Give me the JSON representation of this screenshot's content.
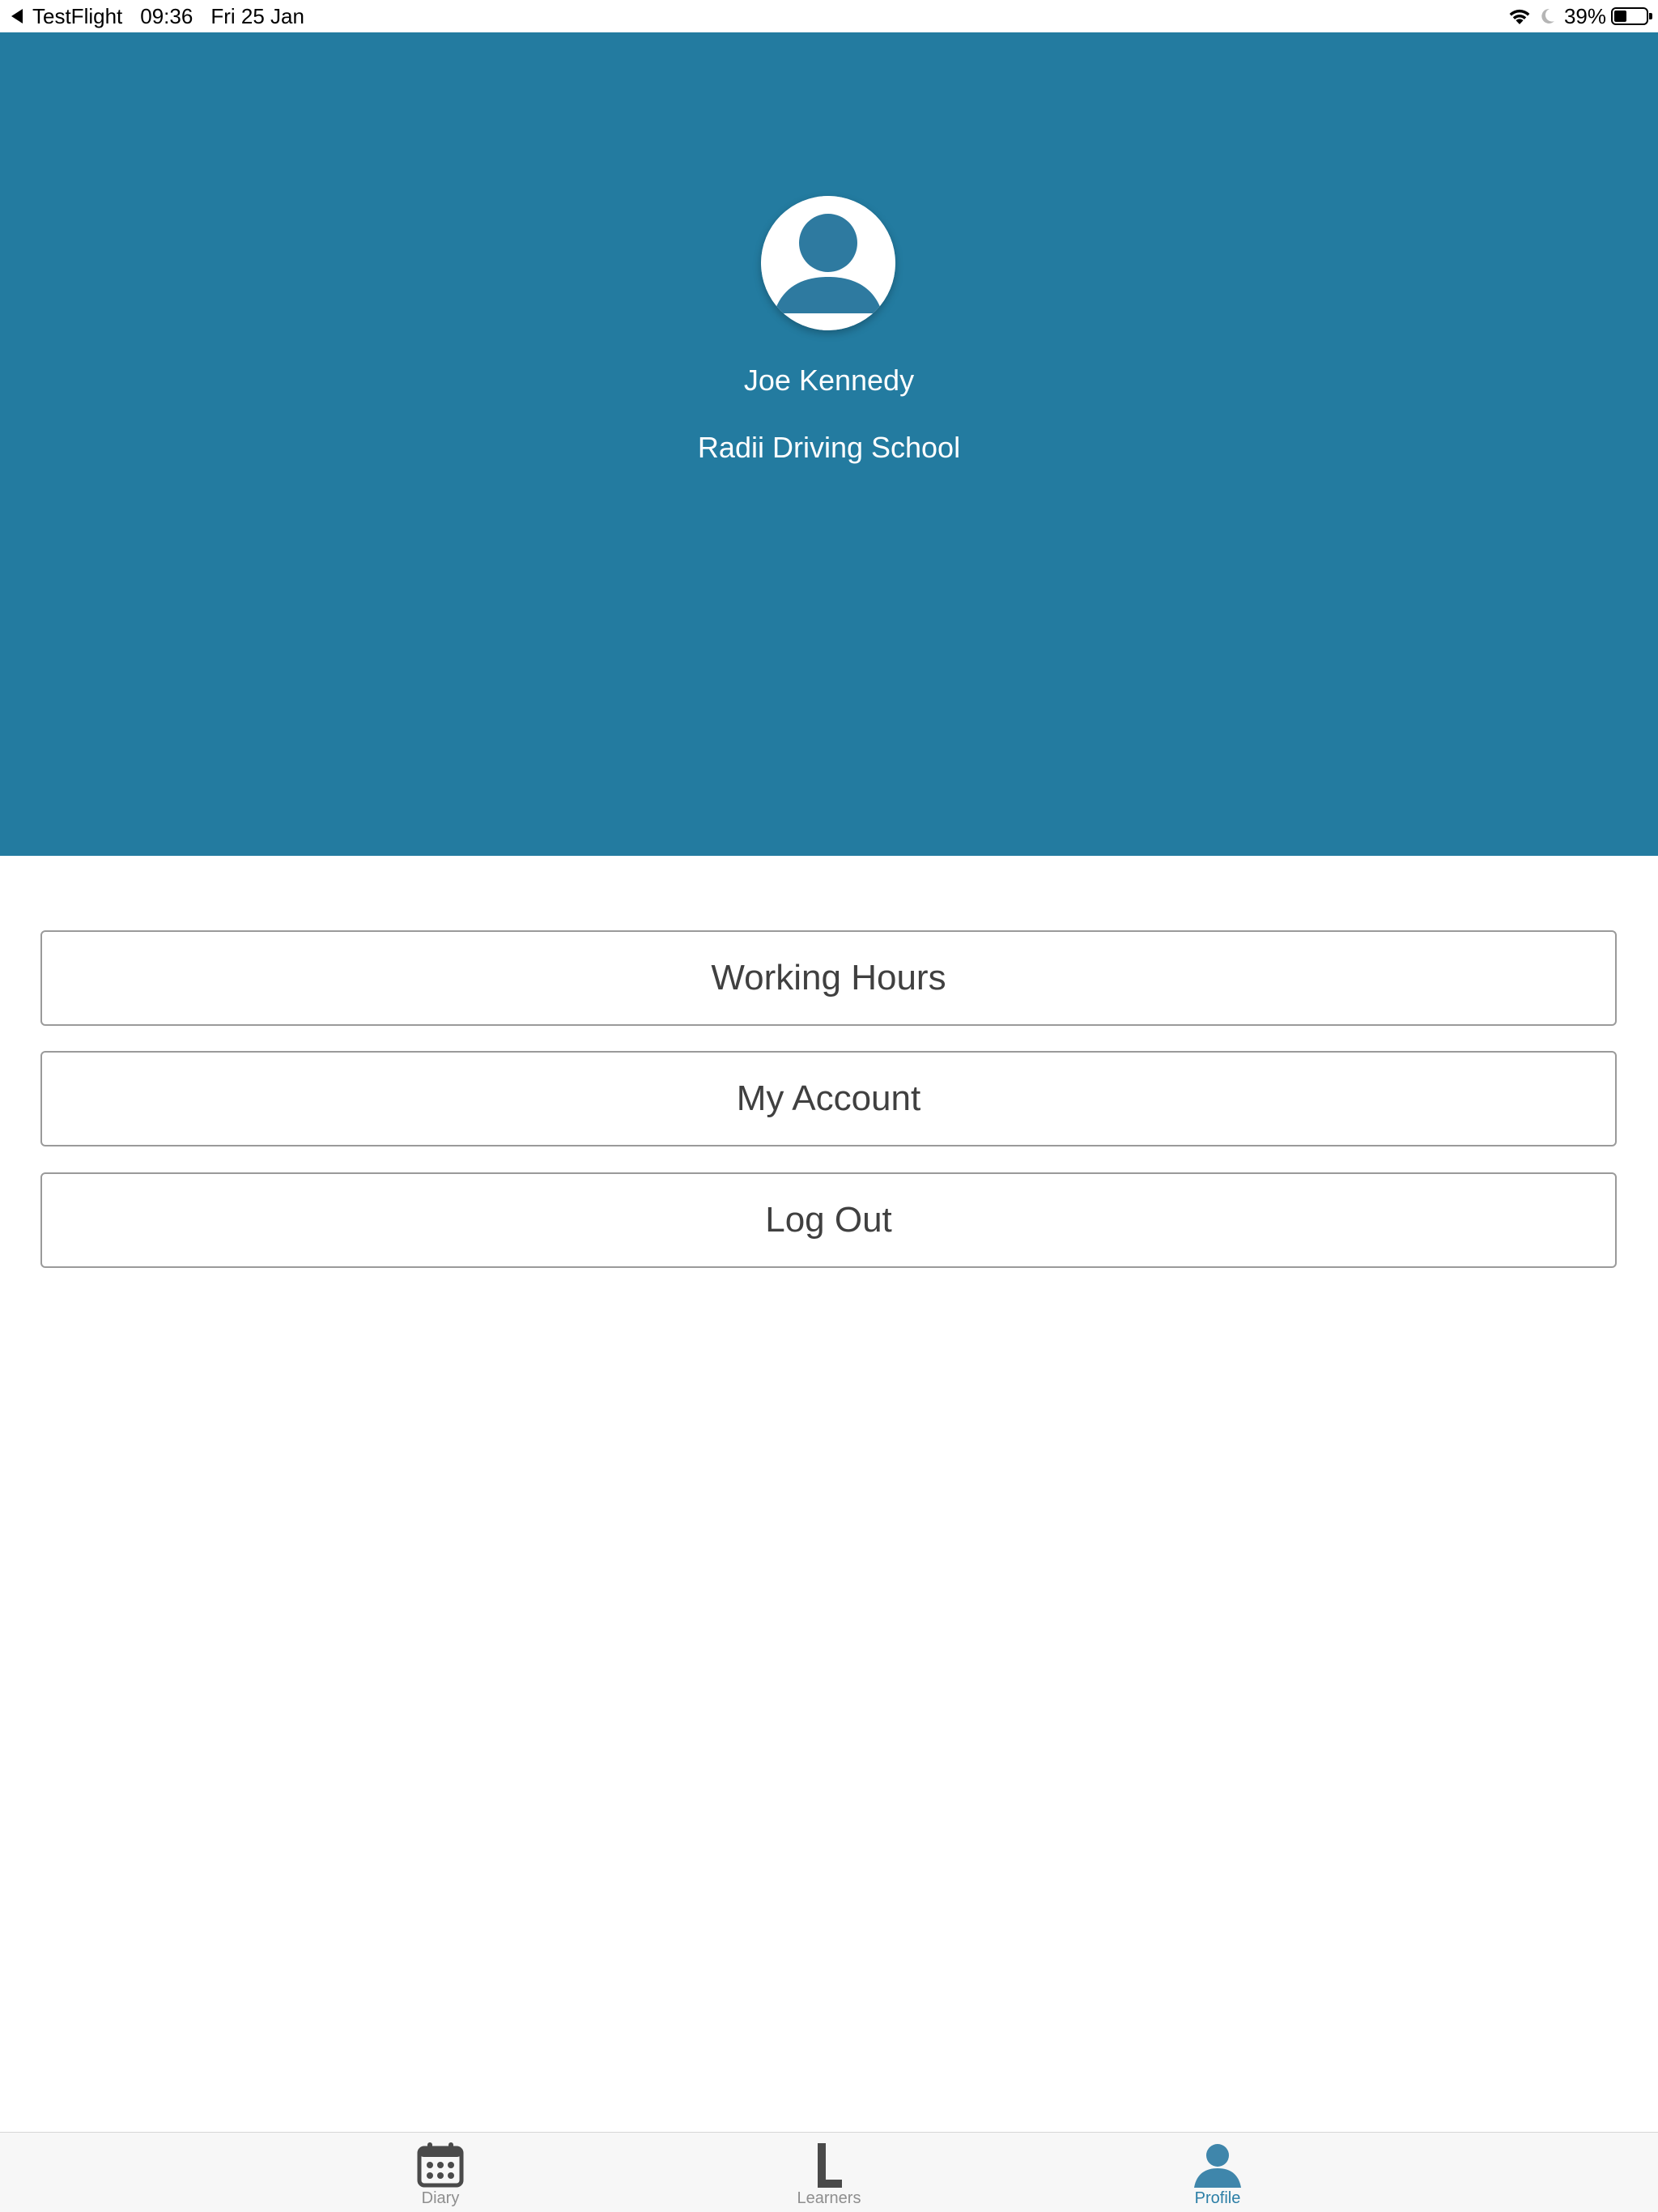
{
  "status_bar": {
    "back_app": "TestFlight",
    "time": "09:36",
    "date": "Fri 25 Jan",
    "battery_percent": "39%",
    "battery_level": 0.39
  },
  "profile": {
    "name": "Joe Kennedy",
    "school": "Radii Driving School",
    "avatar_icon": "user-silhouette-icon"
  },
  "menu": {
    "working_hours": "Working Hours",
    "my_account": "My Account",
    "log_out": "Log Out"
  },
  "tabs": [
    {
      "label": "Diary",
      "icon": "calendar-icon",
      "active": false
    },
    {
      "label": "Learners",
      "icon": "learner-plate-icon",
      "active": false
    },
    {
      "label": "Profile",
      "icon": "person-icon",
      "active": true
    }
  ],
  "colors": {
    "header_bg": "#237ba0",
    "accent": "#2b7ea6",
    "inactive_tab": "#8e8e8e",
    "button_text": "#404040",
    "button_border": "#9a9a9a"
  }
}
